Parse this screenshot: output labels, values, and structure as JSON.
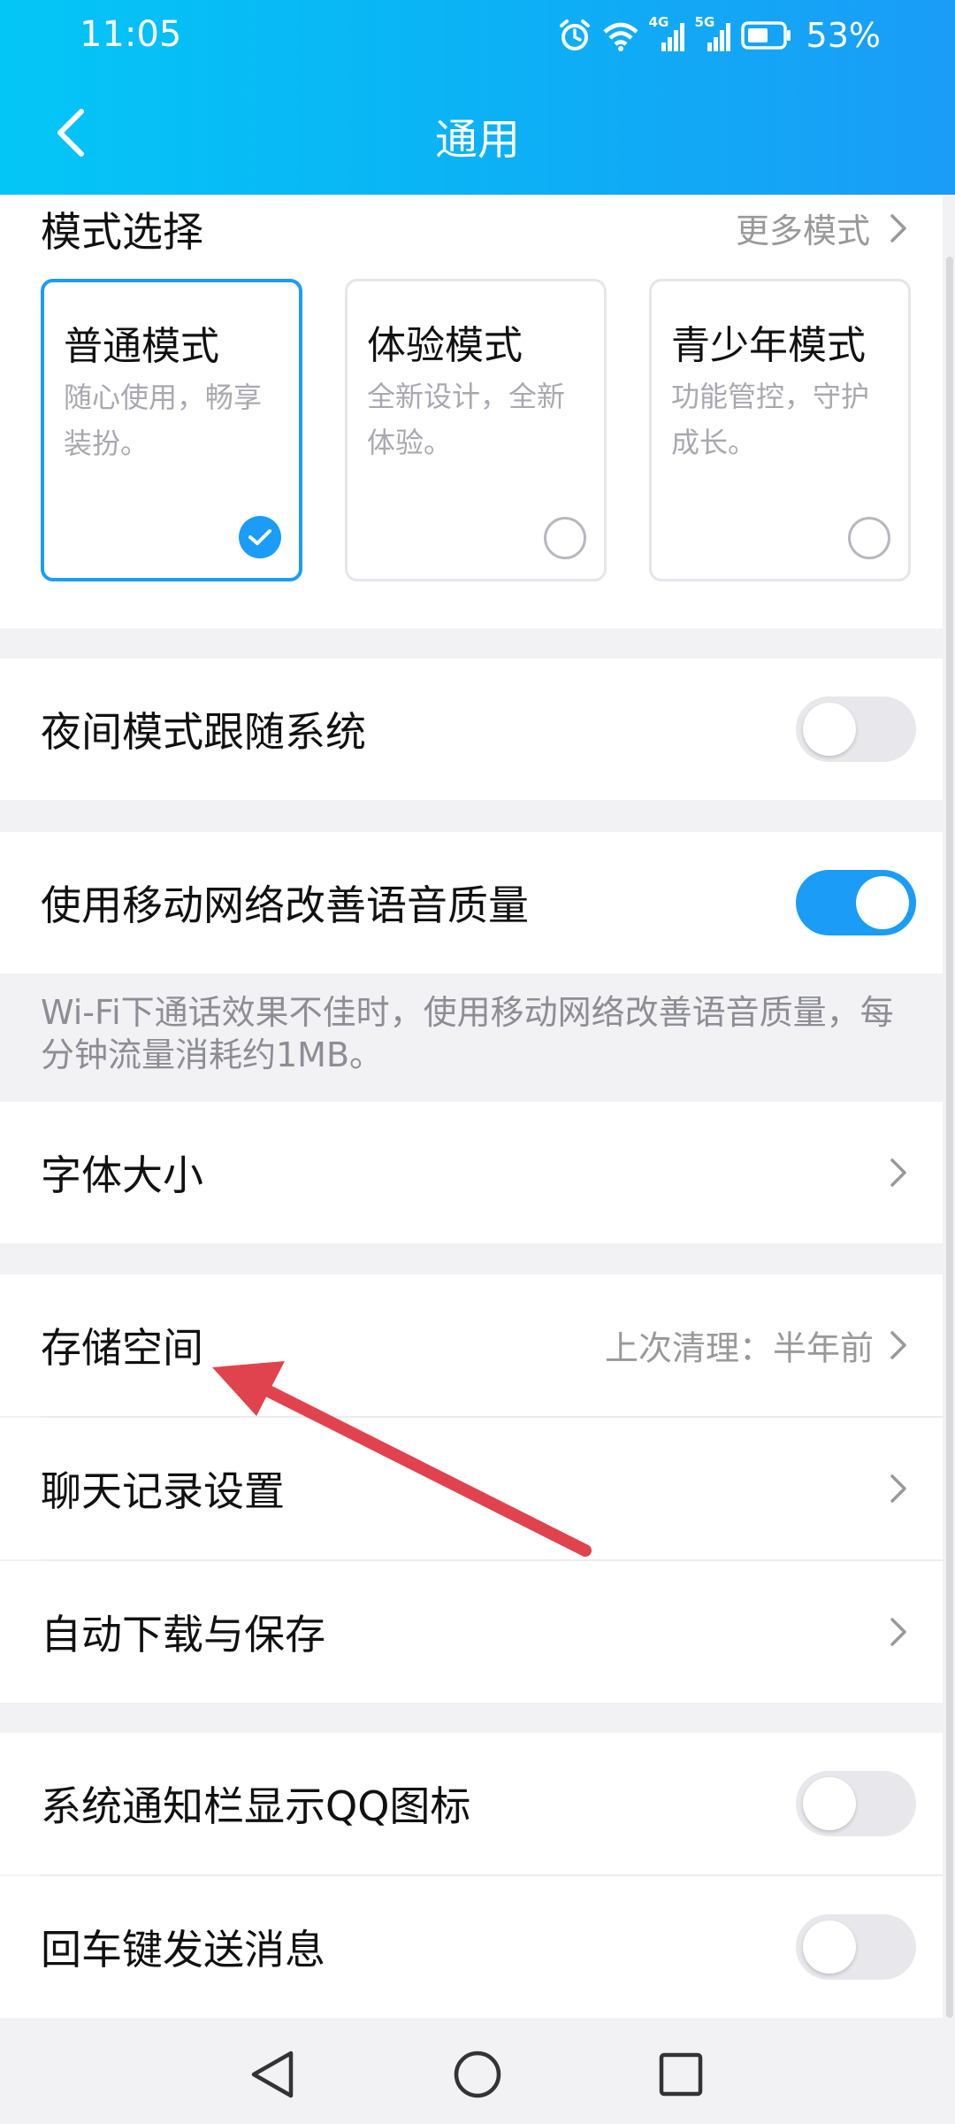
{
  "status_bar": {
    "time": "11:05",
    "network_1": "4G",
    "network_2": "5G",
    "battery": "53%"
  },
  "header": {
    "title": "通用",
    "back_icon": "chevron-left-icon"
  },
  "mode_section": {
    "title": "模式选择",
    "more_label": "更多模式",
    "modes": [
      {
        "title": "普通模式",
        "desc": "随心使用，畅享装扮。",
        "selected": true
      },
      {
        "title": "体验模式",
        "desc": "全新设计，全新体验。",
        "selected": false
      },
      {
        "title": "青少年模式",
        "desc": "功能管控，守护成长。",
        "selected": false
      }
    ]
  },
  "settings": {
    "night_mode": {
      "label": "夜间模式跟随系统",
      "on": false
    },
    "mobile_voice": {
      "label": "使用移动网络改善语音质量",
      "on": true
    },
    "mobile_voice_hint": "Wi-Fi下通话效果不佳时，使用移动网络改善语音质量，每分钟流量消耗约1MB。",
    "font_size": {
      "label": "字体大小"
    },
    "storage": {
      "label": "存储空间",
      "value": "上次清理：半年前"
    },
    "chat_history": {
      "label": "聊天记录设置"
    },
    "auto_download": {
      "label": "自动下载与保存"
    },
    "notify_icon": {
      "label": "系统通知栏显示QQ图标",
      "on": false
    },
    "enter_send": {
      "label": "回车键发送消息",
      "on": false
    }
  },
  "colors": {
    "accent": "#1a9cf7",
    "header_start": "#04c6f6",
    "annotation_arrow": "#e0434e"
  }
}
